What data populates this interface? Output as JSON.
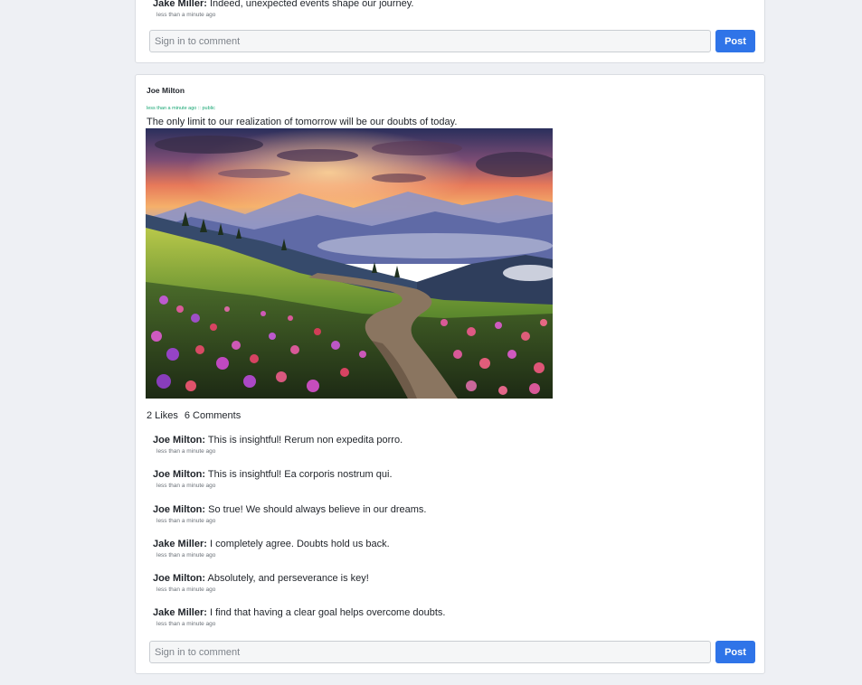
{
  "previous_post": {
    "last_comment": {
      "author": "Jake Miller:",
      "text": "Indeed, unexpected events shape our journey.",
      "time": "less than a minute ago"
    },
    "comment_placeholder": "Sign in to comment",
    "post_label": "Post"
  },
  "post": {
    "author": "Joe Milton",
    "meta": "less than a minute ago :: public",
    "text": "The only limit to our realization of tomorrow will be our doubts of today.",
    "likes": "2 Likes",
    "comments_count": "6 Comments",
    "comments": [
      {
        "author": "Joe Milton:",
        "text": "This is insightful! Rerum non expedita porro.",
        "time": "less than a minute ago"
      },
      {
        "author": "Joe Milton:",
        "text": "This is insightful! Ea corporis nostrum qui.",
        "time": "less than a minute ago"
      },
      {
        "author": "Joe Milton:",
        "text": "So true! We should always believe in our dreams.",
        "time": "less than a minute ago"
      },
      {
        "author": "Jake Miller:",
        "text": "I completely agree. Doubts hold us back.",
        "time": "less than a minute ago"
      },
      {
        "author": "Joe Milton:",
        "text": "Absolutely, and perseverance is key!",
        "time": "less than a minute ago"
      },
      {
        "author": "Jake Miller:",
        "text": "I find that having a clear goal helps overcome doubts.",
        "time": "less than a minute ago"
      }
    ],
    "comment_placeholder": "Sign in to comment",
    "post_label": "Post"
  },
  "colors": {
    "accent": "#2f74e8",
    "meta_green": "#17a673",
    "page_bg": "#eef0f4"
  }
}
